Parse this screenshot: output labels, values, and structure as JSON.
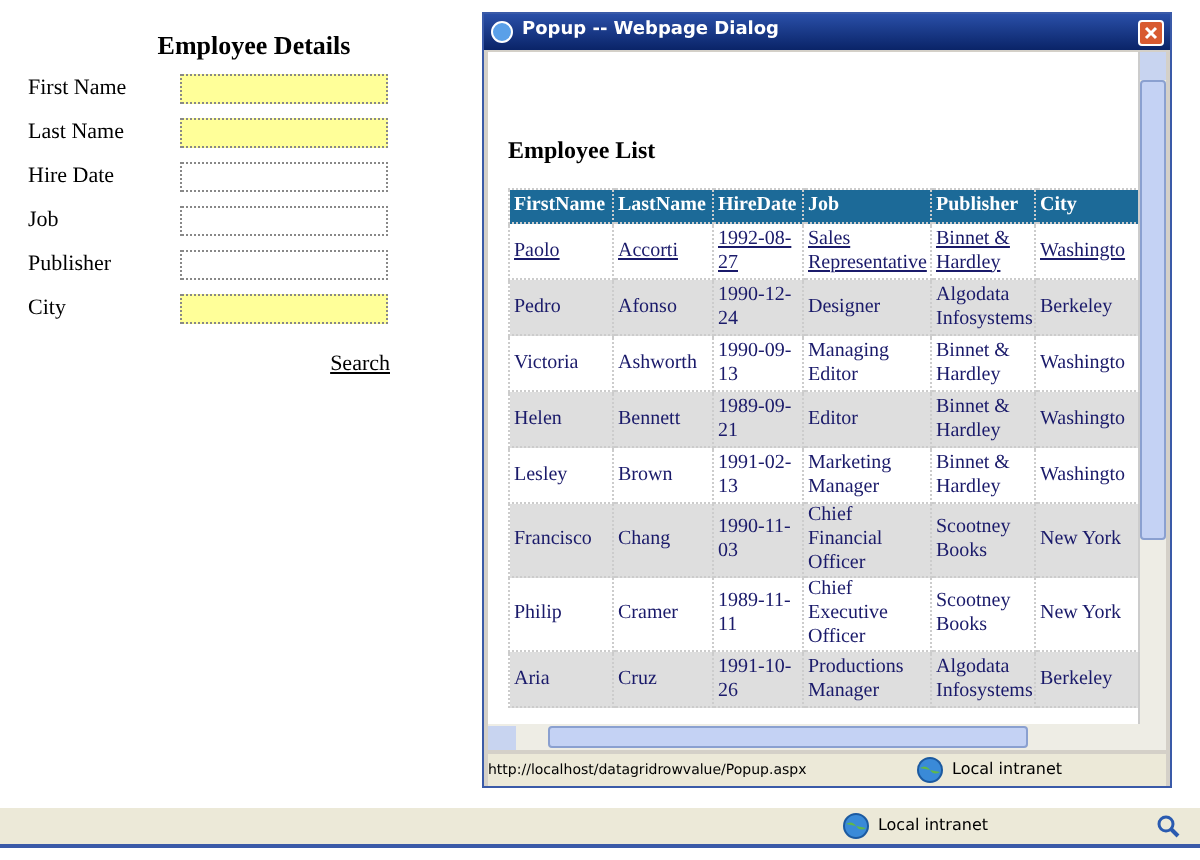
{
  "form": {
    "title": "Employee Details",
    "fields": [
      {
        "label": "First Name",
        "highlighted": true
      },
      {
        "label": "Last Name",
        "highlighted": true
      },
      {
        "label": "Hire Date",
        "highlighted": false
      },
      {
        "label": "Job",
        "highlighted": false
      },
      {
        "label": "Publisher",
        "highlighted": false
      },
      {
        "label": "City",
        "highlighted": true
      }
    ],
    "search_link": "Search"
  },
  "dialog": {
    "title": "Popup -- Webpage Dialog",
    "heading": "Employee List",
    "table": {
      "columns": [
        "FirstName",
        "LastName",
        "HireDate",
        "Job",
        "Publisher",
        "City"
      ],
      "rows": [
        {
          "linked": true,
          "cells": [
            "Paolo",
            "Accorti",
            "1992-08-27",
            "Sales Representative",
            "Binnet & Hardley",
            "Washingto"
          ]
        },
        {
          "linked": false,
          "cells": [
            "Pedro",
            "Afonso",
            "1990-12-24",
            "Designer",
            "Algodata Infosystems",
            "Berkeley"
          ]
        },
        {
          "linked": false,
          "cells": [
            "Victoria",
            "Ashworth",
            "1990-09-13",
            "Managing Editor",
            "Binnet & Hardley",
            "Washingto"
          ]
        },
        {
          "linked": false,
          "cells": [
            "Helen",
            "Bennett",
            "1989-09-21",
            "Editor",
            "Binnet & Hardley",
            "Washingto"
          ]
        },
        {
          "linked": false,
          "cells": [
            "Lesley",
            "Brown",
            "1991-02-13",
            "Marketing Manager",
            "Binnet & Hardley",
            "Washingto"
          ]
        },
        {
          "linked": false,
          "cells": [
            "Francisco",
            "Chang",
            "1990-11-03",
            "Chief Financial Officer",
            "Scootney Books",
            "New York"
          ]
        },
        {
          "linked": false,
          "cells": [
            "Philip",
            "Cramer",
            "1989-11-11",
            "Chief Executive Officer",
            "Scootney Books",
            "New York"
          ]
        },
        {
          "linked": false,
          "cells": [
            "Aria",
            "Cruz",
            "1991-10-26",
            "Productions Manager",
            "Algodata Infosystems",
            "Berkeley"
          ]
        }
      ]
    },
    "status_url": "http://localhost/datagridrowvalue/Popup.aspx",
    "status_zone": "Local intranet"
  },
  "browser_status": {
    "zone": "Local intranet"
  }
}
